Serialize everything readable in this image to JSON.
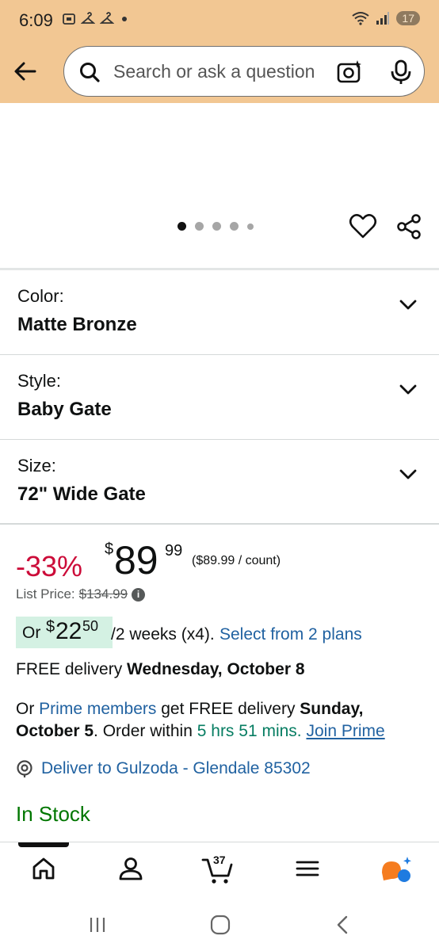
{
  "status_bar": {
    "time": "6:09",
    "battery": "17"
  },
  "search": {
    "placeholder": "Search or ask a question"
  },
  "gallery": {
    "dot_count": 5,
    "active_index": 0
  },
  "variations": [
    {
      "label": "Color:",
      "value": "Matte Bronze"
    },
    {
      "label": "Style:",
      "value": "Baby Gate"
    },
    {
      "label": "Size:",
      "value": "72\" Wide Gate"
    }
  ],
  "price": {
    "discount": "-33%",
    "currency": "$",
    "whole": "89",
    "fraction": "99",
    "per_unit": "($89.99 / count)",
    "list_price_label": "List Price:",
    "list_price_value": "$134.99"
  },
  "installment": {
    "or": "Or",
    "currency": "$",
    "whole": "22",
    "fraction": "50",
    "period": "/2 weeks (x4).",
    "link": "Select from 2 plans"
  },
  "delivery": {
    "prefix": "FREE delivery",
    "date": "Wednesday, October 8"
  },
  "prime": {
    "or": "Or",
    "members_link": "Prime members",
    "get_free": "get FREE delivery",
    "date": "Sunday, October 5",
    "order_within": ". Order within",
    "time_left": "5 hrs 51 mins.",
    "join_link": "Join Prime"
  },
  "deliver_to": "Deliver to Gulzoda - Glendale 85302",
  "stock": "In Stock",
  "bottom_nav": {
    "cart_count": "37"
  },
  "colors": {
    "header_bg": "#f2c793",
    "discount": "#cc0c39",
    "link": "#2162a1",
    "stock": "#007600",
    "installment_bg": "#d4f1e3"
  }
}
